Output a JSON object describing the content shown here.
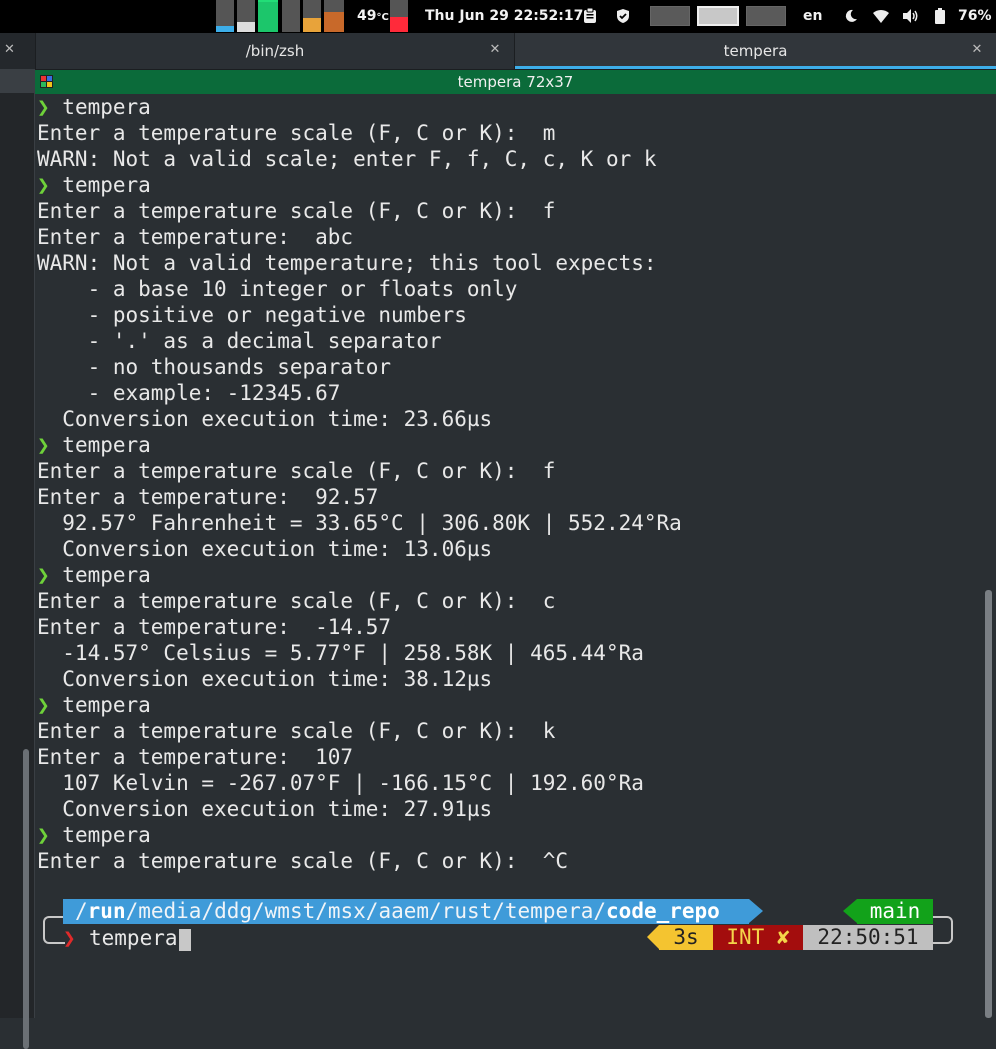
{
  "topbar": {
    "temperature": "49",
    "temperature_unit": "°C",
    "datetime": "Thu Jun 29  22:52:17",
    "keyboard_layout": "en",
    "battery": "76%"
  },
  "tabs": [
    {
      "label": "/bin/zsh",
      "active": false
    },
    {
      "label": "tempera",
      "active": true
    }
  ],
  "terminal": {
    "title": "tempera 72x37",
    "lines": [
      {
        "arrow": "❯",
        "text": " tempera"
      },
      {
        "text": "Enter a temperature scale (F, C or K):  m"
      },
      {
        "text": "WARN: Not a valid scale; enter F, f, C, c, K or k"
      },
      {
        "arrow": "❯",
        "text": " tempera"
      },
      {
        "text": "Enter a temperature scale (F, C or K):  f"
      },
      {
        "text": "Enter a temperature:  abc"
      },
      {
        "text": "WARN: Not a valid temperature; this tool expects:"
      },
      {
        "text": "    - a base 10 integer or floats only"
      },
      {
        "text": "    - positive or negative numbers"
      },
      {
        "text": "    - '.' as a decimal separator"
      },
      {
        "text": "    - no thousands separator"
      },
      {
        "text": "    - example: -12345.67"
      },
      {
        "text": "  Conversion execution time: 23.66µs"
      },
      {
        "arrow": "❯",
        "text": " tempera"
      },
      {
        "text": "Enter a temperature scale (F, C or K):  f"
      },
      {
        "text": "Enter a temperature:  92.57"
      },
      {
        "text": "  92.57° Fahrenheit = 33.65°C | 306.80K | 552.24°Ra"
      },
      {
        "text": "  Conversion execution time: 13.06µs"
      },
      {
        "arrow": "❯",
        "text": " tempera"
      },
      {
        "text": "Enter a temperature scale (F, C or K):  c"
      },
      {
        "text": "Enter a temperature:  -14.57"
      },
      {
        "text": "  -14.57° Celsius = 5.77°F | 258.58K | 465.44°Ra"
      },
      {
        "text": "  Conversion execution time: 38.12µs"
      },
      {
        "arrow": "❯",
        "text": " tempera"
      },
      {
        "text": "Enter a temperature scale (F, C or K):  k"
      },
      {
        "text": "Enter a temperature:  107"
      },
      {
        "text": "  107 Kelvin = -267.07°F | -166.15°C | 192.60°Ra"
      },
      {
        "text": "  Conversion execution time: 27.91µs"
      },
      {
        "arrow": "❯",
        "text": " tempera"
      },
      {
        "text": "Enter a temperature scale (F, C or K):  ^C"
      }
    ]
  },
  "prompt": {
    "path_prefix": "/",
    "path_bold_1": "run",
    "path_mid": "/media/ddg/wmst/msx/aaem/rust/tempera/",
    "path_bold_2": "code_repo",
    "git_branch": "main",
    "arrow": "❯",
    "command": "tempera",
    "duration": "3s",
    "status": "INT ✘",
    "time": "22:50:51"
  },
  "colors": {
    "prompt_green": "#6fd23a",
    "path_blue": "#3f9bd9",
    "git_green": "#12a21a",
    "duration_yellow": "#f4c430",
    "status_red": "#a30d0d",
    "tab_accent": "#3daee9",
    "title_green": "#0b6b3a"
  }
}
